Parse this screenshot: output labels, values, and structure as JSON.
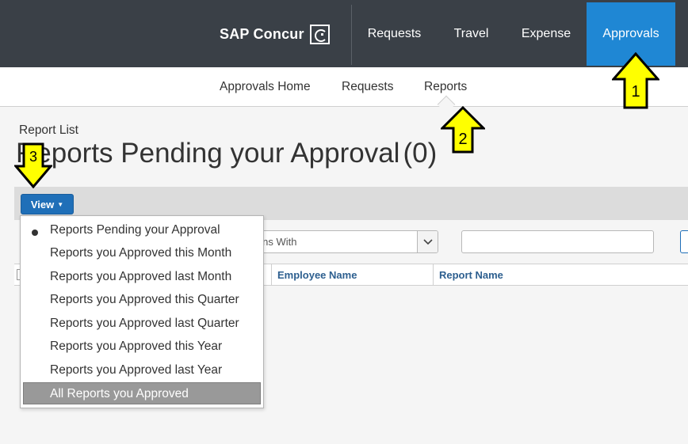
{
  "header": {
    "logo_text": "SAP Concur",
    "nav": [
      {
        "label": "Requests",
        "active": false
      },
      {
        "label": "Travel",
        "active": false
      },
      {
        "label": "Expense",
        "active": false
      },
      {
        "label": "Approvals",
        "active": true
      }
    ],
    "active_color": "#1f87d4",
    "bar_color": "#3a4047"
  },
  "subnav": {
    "items": [
      {
        "label": "Approvals Home"
      },
      {
        "label": "Requests"
      },
      {
        "label": "Reports",
        "active": true
      }
    ]
  },
  "main": {
    "breadcrumb": "Report List",
    "title": "Reports Pending your Approval",
    "count": "(0)",
    "view_button": "View",
    "filter_select_value": "gins With",
    "search_value": "",
    "columns": [
      "Employee Name",
      "Report Name"
    ]
  },
  "view_menu": {
    "items": [
      {
        "label": "Reports Pending your Approval",
        "selected": true
      },
      {
        "label": "Reports you Approved this Month"
      },
      {
        "label": "Reports you Approved last Month"
      },
      {
        "label": "Reports you Approved this Quarter"
      },
      {
        "label": "Reports you Approved last Quarter"
      },
      {
        "label": "Reports you Approved this Year"
      },
      {
        "label": "Reports you Approved last Year"
      },
      {
        "label": "All Reports you Approved",
        "hovered": true
      }
    ]
  },
  "annotations": {
    "color": "#ffff00",
    "labels": [
      "1",
      "2",
      "3"
    ]
  }
}
